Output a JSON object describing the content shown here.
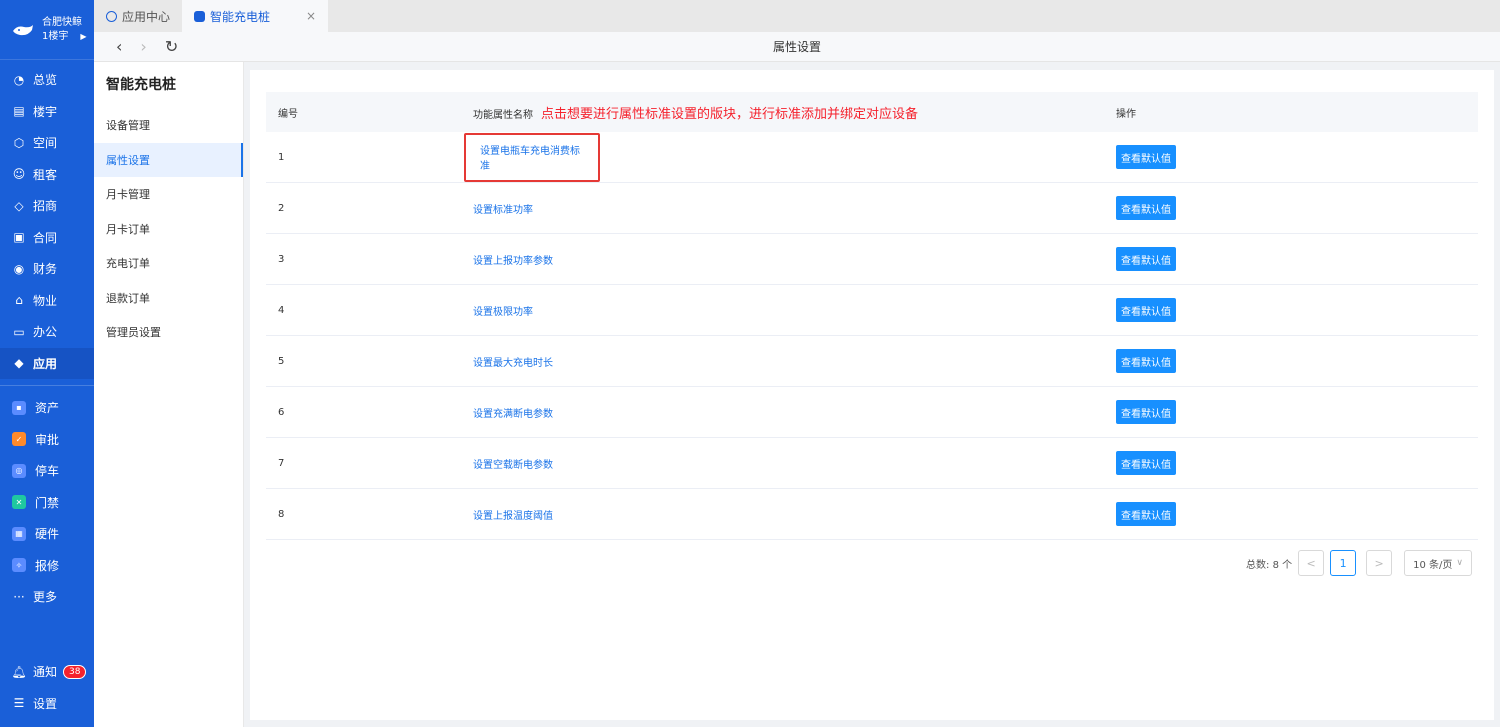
{
  "brand": {
    "name": "合肥快鲸",
    "sub": "1楼宇"
  },
  "nav": {
    "primary": [
      {
        "label": "总览",
        "icon": "dashboard-icon"
      },
      {
        "label": "楼宇",
        "icon": "building-icon"
      },
      {
        "label": "空间",
        "icon": "cube-icon"
      },
      {
        "label": "租客",
        "icon": "users-icon"
      },
      {
        "label": "招商",
        "icon": "tag-icon"
      },
      {
        "label": "合同",
        "icon": "contract-icon"
      },
      {
        "label": "财务",
        "icon": "finance-icon"
      },
      {
        "label": "物业",
        "icon": "home-icon"
      },
      {
        "label": "办公",
        "icon": "monitor-icon"
      },
      {
        "label": "应用",
        "icon": "app-icon"
      }
    ],
    "apps": [
      {
        "label": "资产",
        "color": "#5b8cff"
      },
      {
        "label": "审批",
        "color": "#ff8a2b"
      },
      {
        "label": "停车",
        "color": "#5b8cff"
      },
      {
        "label": "门禁",
        "color": "#1fc8a0"
      },
      {
        "label": "硬件",
        "color": "#5b8cff"
      },
      {
        "label": "报修",
        "color": "#5b8cff"
      }
    ],
    "more": "更多",
    "notify": "通知",
    "notify_count": "38",
    "settings": "设置"
  },
  "tabs": [
    {
      "label": "应用中心"
    },
    {
      "label": "智能充电桩"
    }
  ],
  "tab_close": "×",
  "titlebar": {
    "title": "属性设置",
    "back": "‹",
    "forward": "›",
    "refresh": "↻"
  },
  "submenu": {
    "title": "智能充电桩",
    "items": [
      "设备管理",
      "属性设置",
      "月卡管理",
      "月卡订单",
      "充电订单",
      "退款订单",
      "管理员设置"
    ]
  },
  "table": {
    "headers": {
      "no": "编号",
      "name": "功能属性名称",
      "op": "操作"
    },
    "hint": "点击想要进行属性标准设置的版块，进行标准添加并绑定对应设备",
    "action_label": "查看默认值",
    "rows": [
      {
        "no": "1",
        "name": "设置电瓶车充电消费标准"
      },
      {
        "no": "2",
        "name": "设置标准功率"
      },
      {
        "no": "3",
        "name": "设置上报功率参数"
      },
      {
        "no": "4",
        "name": "设置极限功率"
      },
      {
        "no": "5",
        "name": "设置最大充电时长"
      },
      {
        "no": "6",
        "name": "设置充满断电参数"
      },
      {
        "no": "7",
        "name": "设置空载断电参数"
      },
      {
        "no": "8",
        "name": "设置上报温度阈值"
      }
    ]
  },
  "pager": {
    "total": "总数: 8 个",
    "current": "1",
    "size": "10 条/页",
    "prev": "<",
    "next": ">"
  }
}
